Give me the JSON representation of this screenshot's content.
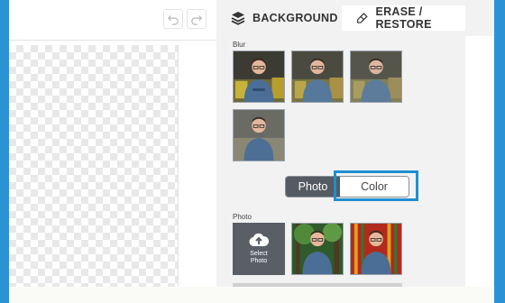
{
  "toolbar": {
    "undo_icon": "undo-icon",
    "redo_icon": "redo-icon"
  },
  "tabs": [
    {
      "label": "BACKGROUND",
      "icon": "layers-icon",
      "active": true
    },
    {
      "label": "ERASE / RESTORE",
      "icon": "eraser-icon",
      "active": false
    }
  ],
  "background_panel": {
    "blur_label": "Blur",
    "toggle": {
      "photo_label": "Photo",
      "color_label": "Color",
      "selected": "Photo",
      "highlighted": "Color"
    },
    "photo_label": "Photo",
    "select_photo": {
      "line1": "Select",
      "line2": "Photo",
      "icon": "upload-cloud-icon"
    }
  },
  "colors": {
    "accent_blue": "#2a93d5",
    "toggle_active_bg": "#555b62",
    "panel_bg": "#f2f2f2",
    "highlight": "#1f8fd0"
  }
}
